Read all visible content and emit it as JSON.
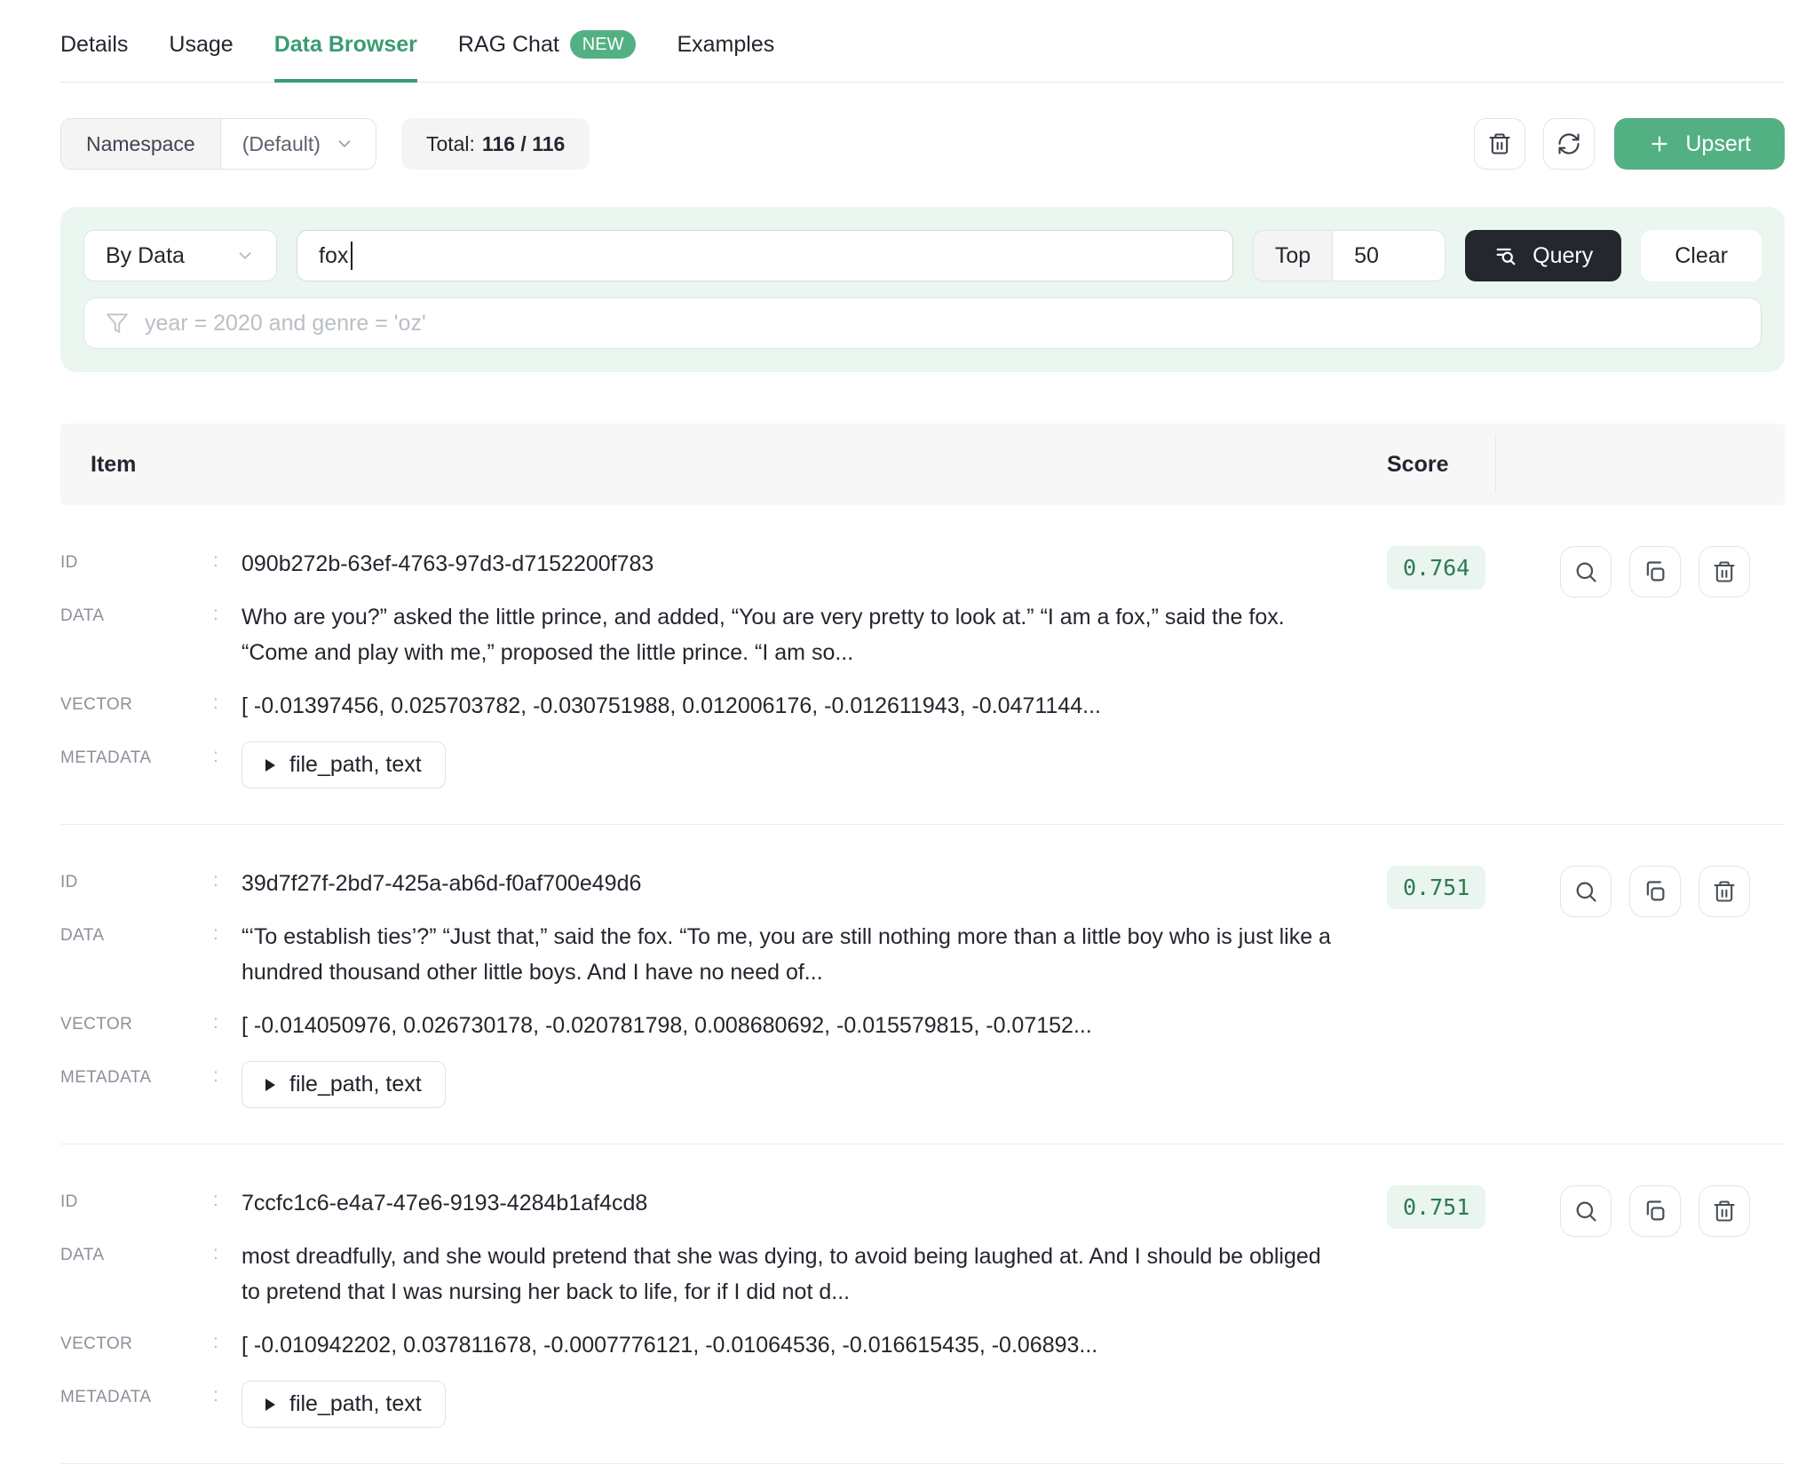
{
  "tabs": [
    {
      "label": "Details"
    },
    {
      "label": "Usage"
    },
    {
      "label": "Data Browser"
    },
    {
      "label": "RAG Chat",
      "badge": "NEW"
    },
    {
      "label": "Examples"
    }
  ],
  "toolbar": {
    "namespace_label": "Namespace",
    "namespace_value": "(Default)",
    "total_label": "Total:",
    "total_value": "116 / 116",
    "upsert_label": "Upsert"
  },
  "query": {
    "mode": "By Data",
    "search_value": "fox",
    "top_label": "Top",
    "top_value": "50",
    "query_label": "Query",
    "clear_label": "Clear",
    "filter_placeholder": "year = 2020 and genre = 'oz'"
  },
  "table": {
    "headers": {
      "item": "Item",
      "score": "Score"
    },
    "field_labels": {
      "id": "ID",
      "data": "DATA",
      "vector": "VECTOR",
      "metadata": "METADATA"
    },
    "rows": [
      {
        "id": "090b272b-63ef-4763-97d3-d7152200f783",
        "data": "Who are you?” asked the little prince, and added, “You are very pretty to look at.” “I am a fox,” said the fox. “Come and play with me,” proposed the little prince. “I am so...",
        "vector": "[ -0.01397456, 0.025703782, -0.030751988, 0.012006176, -0.012611943, -0.0471144...",
        "metadata_keys": "file_path, text",
        "score": "0.764"
      },
      {
        "id": "39d7f27f-2bd7-425a-ab6d-f0af700e49d6",
        "data": "“‘To establish ties’?” “Just that,” said the fox. “To me, you are still nothing more than a little boy who is just like a hundred thousand other little boys. And I have no need of...",
        "vector": "[ -0.014050976, 0.026730178, -0.020781798, 0.008680692, -0.015579815, -0.07152...",
        "metadata_keys": "file_path, text",
        "score": "0.751"
      },
      {
        "id": "7ccfc1c6-e4a7-47e6-9193-4284b1af4cd8",
        "data": "most dreadfully, and she would pretend that she was dying, to avoid being laughed at. And I should be obliged to pretend that I was nursing her back to life, for if I did not d...",
        "vector": "[ -0.010942202, 0.037811678, -0.0007776121, -0.01064536, -0.016615435, -0.06893...",
        "metadata_keys": "file_path, text",
        "score": "0.751"
      }
    ]
  },
  "colors": {
    "accent_green": "#53b083",
    "active_tab_green": "#3b9b72",
    "score_text": "#2c7a52",
    "score_bg": "#e9f5ee",
    "panel_bg": "#eaf6ef",
    "query_button_bg": "#24272e"
  }
}
